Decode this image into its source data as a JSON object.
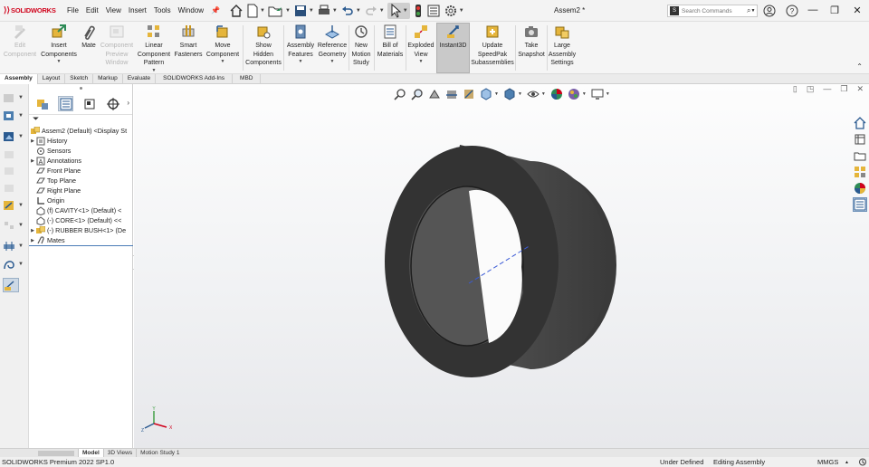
{
  "app": {
    "logo_text": "SOLIDWORKS",
    "document_title": "Assem2 *"
  },
  "menu": [
    "File",
    "Edit",
    "View",
    "Insert",
    "Tools",
    "Window"
  ],
  "search": {
    "placeholder": "Search Commands"
  },
  "ribbon": {
    "commands": [
      {
        "label": "Edit\nComponent",
        "enabled": false,
        "dropdown": false
      },
      {
        "label": "Insert\nComponents",
        "enabled": true,
        "dropdown": true
      },
      {
        "label": "Mate",
        "enabled": true,
        "dropdown": false
      },
      {
        "label": "Component\nPreview\nWindow",
        "enabled": false,
        "dropdown": false
      },
      {
        "label": "Linear\nComponent\nPattern",
        "enabled": true,
        "dropdown": true
      },
      {
        "label": "Smart\nFasteners",
        "enabled": true,
        "dropdown": false
      },
      {
        "label": "Move\nComponent",
        "enabled": true,
        "dropdown": true
      },
      {
        "label": "Show\nHidden\nComponents",
        "enabled": true,
        "dropdown": false
      },
      {
        "label": "Assembly\nFeatures",
        "enabled": true,
        "dropdown": true
      },
      {
        "label": "Reference\nGeometry",
        "enabled": true,
        "dropdown": true
      },
      {
        "label": "New\nMotion\nStudy",
        "enabled": true,
        "dropdown": false
      },
      {
        "label": "Bill of\nMaterials",
        "enabled": true,
        "dropdown": false
      },
      {
        "label": "Exploded\nView",
        "enabled": true,
        "dropdown": true
      },
      {
        "label": "Instant3D",
        "enabled": true,
        "dropdown": false,
        "active": true
      },
      {
        "label": "Update\nSpeedPak\nSubassemblies",
        "enabled": true,
        "dropdown": false
      },
      {
        "label": "Take\nSnapshot",
        "enabled": true,
        "dropdown": false
      },
      {
        "label": "Large\nAssembly\nSettings",
        "enabled": true,
        "dropdown": false
      }
    ]
  },
  "tabs": [
    "Assembly",
    "Layout",
    "Sketch",
    "Markup",
    "Evaluate",
    "SOLIDWORKS Add-Ins",
    "MBD"
  ],
  "active_tab": "Assembly",
  "tree": {
    "root": "Assem2 (Default) <Display St",
    "items": [
      {
        "label": "History",
        "expandable": true,
        "icon": "history-icon"
      },
      {
        "label": "Sensors",
        "expandable": false,
        "icon": "sensor-icon"
      },
      {
        "label": "Annotations",
        "expandable": true,
        "icon": "annotation-icon"
      },
      {
        "label": "Front Plane",
        "expandable": false,
        "icon": "plane-icon"
      },
      {
        "label": "Top Plane",
        "expandable": false,
        "icon": "plane-icon"
      },
      {
        "label": "Right Plane",
        "expandable": false,
        "icon": "plane-icon"
      },
      {
        "label": "Origin",
        "expandable": false,
        "icon": "origin-icon"
      },
      {
        "label": "(f) CAVITY<1> (Default) <",
        "expandable": false,
        "icon": "part-icon"
      },
      {
        "label": "(-) CORE<1> (Default) <<",
        "expandable": false,
        "icon": "part-icon"
      },
      {
        "label": "(-) RUBBER BUSH<1> (De",
        "expandable": true,
        "icon": "subassembly-icon"
      },
      {
        "label": "Mates",
        "expandable": true,
        "icon": "mates-icon"
      }
    ]
  },
  "bottom_tabs": [
    "Model",
    "3D Views",
    "Motion Study 1"
  ],
  "active_bottom_tab": "Model",
  "status": {
    "product": "SOLIDWORKS Premium 2022 SP1.0",
    "definition": "Under Defined",
    "mode": "Editing Assembly",
    "units": "MMGS"
  },
  "colors": {
    "brand": "#d0021b",
    "part_dark": "#3b3b3b",
    "selection_blue": "#4a7bb7"
  }
}
